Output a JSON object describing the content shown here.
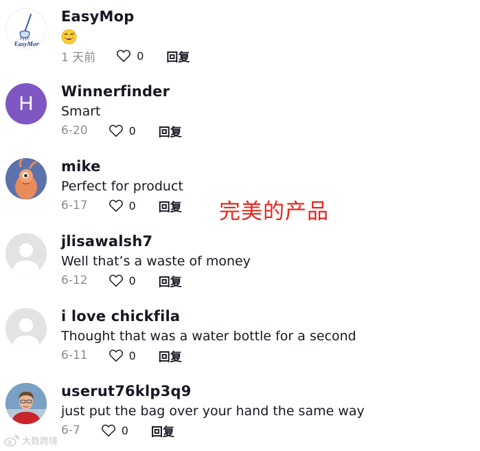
{
  "comments": [
    {
      "username": "EasyMop",
      "avatar_icon": "easymop-logo-icon",
      "avatar_text": "EasyMop",
      "text": "",
      "emoji": "grinning-sweat-emoji",
      "date": "1 天前",
      "likes": "0",
      "reply": "回复"
    },
    {
      "username": "Winnerfinder",
      "avatar_letter": "H",
      "avatar_color": "#7e57c2",
      "text": "Smart",
      "date": "6-20",
      "likes": "0",
      "reply": "回复"
    },
    {
      "username": "mike",
      "avatar_icon": "cartoon-shrimp-icon",
      "text": "Perfect for product",
      "date": "6-17",
      "likes": "0",
      "reply": "回复"
    },
    {
      "username": "jlisawalsh7",
      "avatar_icon": "default-user-icon",
      "text": "Well that’s a waste of money",
      "date": "6-12",
      "likes": "0",
      "reply": "回复"
    },
    {
      "username": "i love chickfila",
      "avatar_icon": "default-user-icon",
      "text": "Thought that was a water bottle for a second",
      "date": "6-11",
      "likes": "0",
      "reply": "回复"
    },
    {
      "username": "userut76klp3q9",
      "avatar_icon": "user-photo-icon",
      "text": "just put the bag over your hand the same way",
      "date": "6-7",
      "likes": "0",
      "reply": "回复"
    }
  ],
  "annotation": {
    "text": "完美的产品",
    "color": "#e8261c"
  },
  "watermark": {
    "text": "大数跨境",
    "icon": "weibo-icon"
  },
  "colors": {
    "secondary_text": "#8a8b91",
    "primary_text": "#161823",
    "default_avatar_bg": "#e3e3e6"
  }
}
